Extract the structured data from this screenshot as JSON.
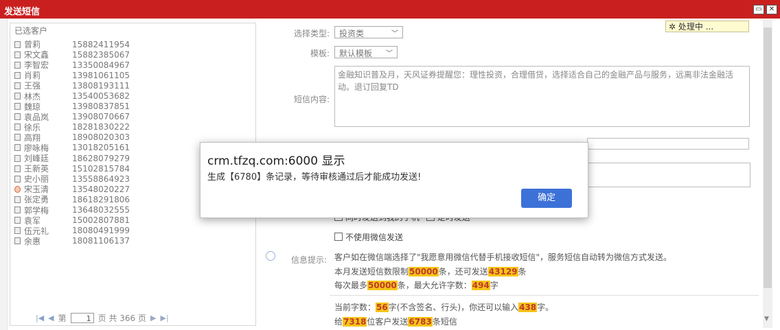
{
  "window": {
    "title": "发送短信"
  },
  "processing": {
    "icon": "spinner-icon",
    "text": "处理中 ..."
  },
  "customers": {
    "header": "已选客户",
    "items": [
      {
        "name": "曾莉",
        "phone": "15882411954"
      },
      {
        "name": "宋文鑫",
        "phone": "15882385067"
      },
      {
        "name": "李智宏",
        "phone": "13350084967"
      },
      {
        "name": "肖莉",
        "phone": "13981061105"
      },
      {
        "name": "王强",
        "phone": "13808193111"
      },
      {
        "name": "林杰",
        "phone": "13540053682"
      },
      {
        "name": "魏琼",
        "phone": "13980837851"
      },
      {
        "name": "袁品岚",
        "phone": "13908070667"
      },
      {
        "name": "徐乐",
        "phone": "18281830222"
      },
      {
        "name": "高翔",
        "phone": "18908020303"
      },
      {
        "name": "廖咏梅",
        "phone": "13018205161"
      },
      {
        "name": "刘峰廷",
        "phone": "18628079279"
      },
      {
        "name": "王新英",
        "phone": "15102815784"
      },
      {
        "name": "史小丽",
        "phone": "13558864923"
      },
      {
        "name": "宋玉清",
        "phone": "13548020227"
      },
      {
        "name": "张定勇",
        "phone": "18618291806"
      },
      {
        "name": "郭学梅",
        "phone": "13648032555"
      },
      {
        "name": "袁军",
        "phone": "15002807881"
      },
      {
        "name": "伍元礼",
        "phone": "18080491999"
      },
      {
        "name": "余惠",
        "phone": "18081106137"
      }
    ]
  },
  "pager": {
    "page_prefix": "第",
    "current": "1",
    "total_text": "页 共 366 页"
  },
  "form": {
    "type_label": "选择类型:",
    "type_value": "投资类",
    "template_label": "模板:",
    "template_value": "默认模板",
    "content_label": "短信内容:",
    "content_text": "金融知识普及月，天风证券提醒您：理性投资，合理借贷，选择适合自己的金融产品与服务，远离非法金融活动。退订回复TD",
    "send_to_phone_label": "同时发送到我的手机",
    "timed_send_label": "定时发送",
    "no_wechat_label": "不使用微信发送"
  },
  "info": {
    "label": "信息提示:",
    "line1": "客户如在微信端选择了\"我愿意用微信代替手机接收短信\"，服务短信自动转为微信方式发送。",
    "line2_a": "本月发送短信数限制",
    "line2_limit": "50000",
    "line2_b": "条，还可发送",
    "line2_remaining": "43129",
    "line2_c": "条",
    "line3_a": "每次最多",
    "line3_max": "50000",
    "line3_b": "条，最大允许字数：",
    "line3_chars": "494",
    "line3_c": "字",
    "line4_a": "当前字数：",
    "line4_count": "56",
    "line4_b": "字(不含签名、行头)，你还可以输入",
    "line4_left": "438",
    "line4_c": "字。",
    "line5_a": "给",
    "line5_customers": "7318",
    "line5_b": "位客户发送",
    "line5_msgs": "6783",
    "line5_c": "条短信"
  },
  "dialog": {
    "title": "crm.tfzq.com:6000 显示",
    "message": "生成【6780】条记录，等待审核通过后才能成功发送!",
    "ok_label": "确定",
    "ok_color": "#3c72d8"
  },
  "colors": {
    "titlebar": "#c9201f",
    "highlight": "#f5c518",
    "highlight_text": "#c0392b"
  }
}
